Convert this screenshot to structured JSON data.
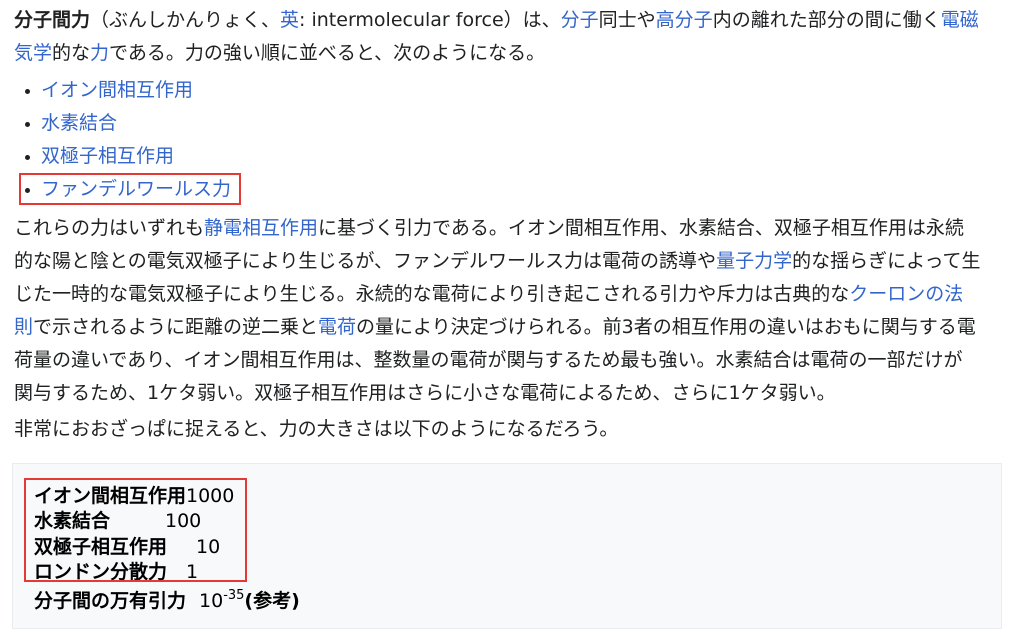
{
  "intro": {
    "term": "分子間力",
    "t1": "（ぶんしかんりょく、",
    "link_en": "英",
    "t2": ": intermolecular force）は、",
    "link_molecule": "分子",
    "t3": "同士や",
    "link_polymer": "高分子",
    "t4": "内の離れた部分の間に働く",
    "link_em_a": "電磁",
    "link_em_b": "気学",
    "t5": "的な",
    "link_force": "力",
    "t6": "である。力の強い順に並べると、次のようになる。"
  },
  "force_list": [
    "イオン間相互作用",
    "水素結合",
    "双極子相互作用",
    "ファンデルワールス力"
  ],
  "para2": {
    "line1_a": "これらの力はいずれも",
    "line1_link": "静電相互作用",
    "line1_b": "に基づく引力である。イオン間相互作用、水素結合、双極子相互作用は永続",
    "line2_a": "的な陽と陰との電気双極子により生じるが、ファンデルワールス力は電荷の誘導や",
    "line2_link": "量子力学",
    "line2_b": "的な揺らぎによって生",
    "line3_a": "じた一時的な電気双極子により生じる。永続的な電荷により引き起こされる引力や斥力は古典的な",
    "line3_link": "クーロンの法",
    "line4_link": "則",
    "line4_a": "で示されるように距離の逆二乗と",
    "line4_link2": "電荷",
    "line4_b": "の量により決定づけられる。前3者の相互作用の違いはおもに関与する電",
    "line5": "荷量の違いであり、イオン間相互作用は、整数量の電荷が関与するため最も強い。水素結合は電荷の一部だけが",
    "line6": "関与するため、1ケタ弱い。双極子相互作用はさらに小さな電荷によるため、さらに1ケタ弱い。"
  },
  "para3": "非常におおざっぱに捉えると、力の大きさは以下のようになるだろう。",
  "strength_table": [
    {
      "name": "イオン間相互作用",
      "value": "1000"
    },
    {
      "name": "水素結合",
      "value": "100"
    },
    {
      "name": "双極子相互作用",
      "value": "10"
    },
    {
      "name": "ロンドン分散力",
      "value": "1"
    }
  ],
  "gravity": {
    "name": "分子間の万有引力",
    "base": "10",
    "exponent": "-35",
    "note": "(参考)"
  },
  "colors": {
    "link": "#3366cc",
    "highlight": "#e53935",
    "text": "#202122"
  }
}
